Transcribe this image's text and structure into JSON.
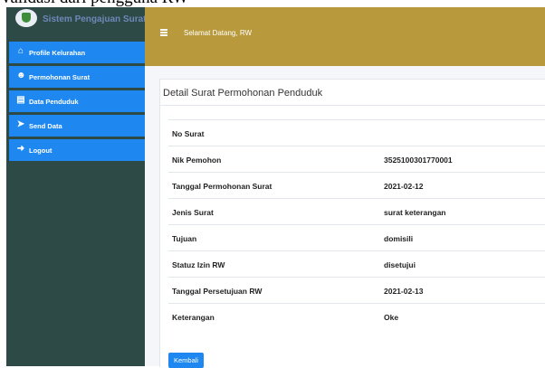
{
  "caption": "validasi dari pengguna RW",
  "sidebar": {
    "brand": "Sistem Pengajuan Surat",
    "items": [
      {
        "label": "Profile Kelurahan",
        "icon": "home-icon"
      },
      {
        "label": "Permohonan Surat",
        "icon": "users-icon"
      },
      {
        "label": "Data Penduduk",
        "icon": "file-icon"
      },
      {
        "label": "Send Data",
        "icon": "send-file-icon"
      },
      {
        "label": "Logout",
        "icon": "logout-icon"
      }
    ]
  },
  "topbar": {
    "welcome": "Selamat Datang, RW"
  },
  "detail": {
    "title": "Detail Surat Permohonan Penduduk",
    "rows": [
      {
        "key": "No Surat",
        "value": ""
      },
      {
        "key": "Nik Pemohon",
        "value": "3525100301770001"
      },
      {
        "key": "Tanggal Permohonan Surat",
        "value": "2021-02-12"
      },
      {
        "key": "Jenis Surat",
        "value": "surat keterangan"
      },
      {
        "key": "Tujuan",
        "value": "domisili"
      },
      {
        "key": "Statuz Izin RW",
        "value": "disetujui"
      },
      {
        "key": "Tanggal Persetujuan RW",
        "value": "2021-02-13"
      },
      {
        "key": "Keterangan",
        "value": "Oke"
      }
    ],
    "back_label": "Kembali"
  },
  "colors": {
    "sidebar": "#2d4a46",
    "menu_item": "#1e88f0",
    "topbar": "#b89a3c",
    "button": "#1e88f0"
  }
}
